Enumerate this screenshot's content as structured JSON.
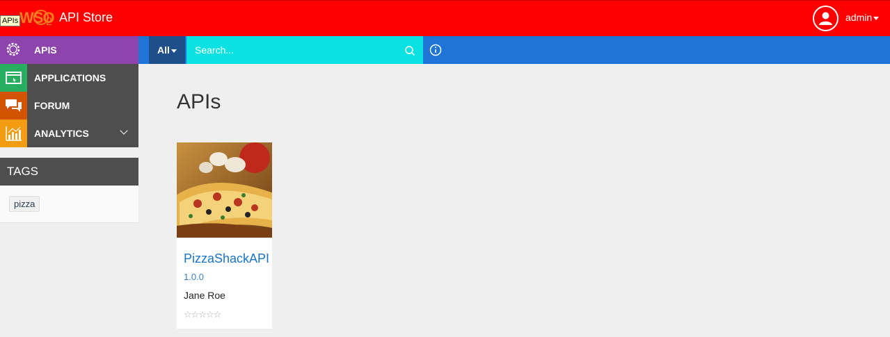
{
  "header": {
    "logo_text": "WSO",
    "logo_sub": "2",
    "logo_tooltip": "APIs",
    "title": "API Store",
    "user": "admin",
    "color": "#ff0000"
  },
  "nav": {
    "items": [
      {
        "label": "APIS",
        "icon": "api-gear-icon",
        "color": "#8e44ad"
      },
      {
        "label": "APPLICATIONS",
        "icon": "application-window-icon",
        "color": "#27ae60"
      },
      {
        "label": "FORUM",
        "icon": "chat-bubbles-icon",
        "color": "#d35400"
      },
      {
        "label": "ANALYTICS",
        "icon": "chart-icon",
        "color": "#f39c12"
      }
    ]
  },
  "search": {
    "filter_label": "All",
    "placeholder": "Search..."
  },
  "tags": {
    "title": "TAGS",
    "items": [
      "pizza"
    ]
  },
  "main": {
    "title": "APIs",
    "apis": [
      {
        "name": "PizzaShackAPI",
        "version": "1.0.0",
        "author": "Jane Roe",
        "rating": 0,
        "rating_max": 5,
        "stars": "☆☆☆☆☆"
      }
    ]
  }
}
